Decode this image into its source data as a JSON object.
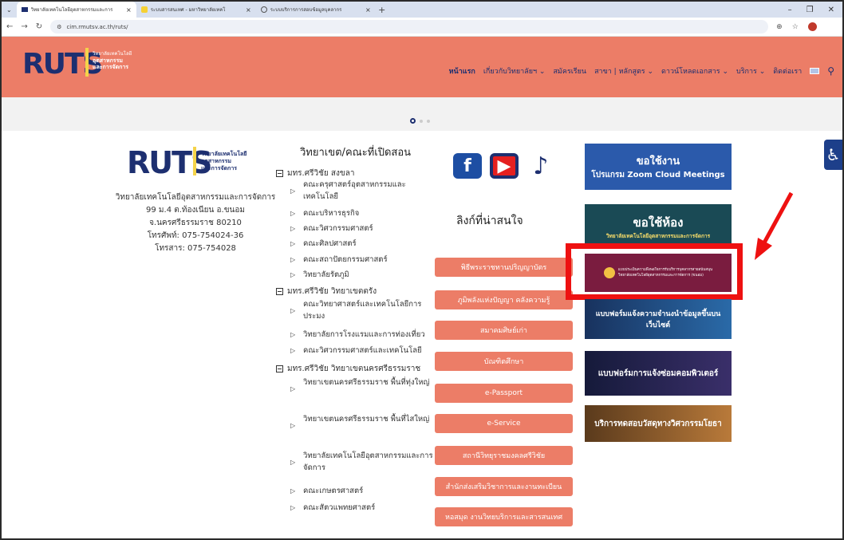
{
  "browser": {
    "tabs": [
      {
        "label": "วิทยาลัยเทคโนโลยีอุตสาหกรรมและการ"
      },
      {
        "label": "ระบบสารสนเทศ - มหาวิทยาลัยเทคโ"
      },
      {
        "label": "ระบบบริการการสอบข้อมูลบุคลากร"
      }
    ],
    "url": "cim.rmutsv.ac.th/ruts/"
  },
  "site": {
    "logo_text": "RUTS",
    "logo_sub": [
      "วิทยาลัยเทคโนโลยี",
      "อุตสาหกรรม",
      "และการจัดการ"
    ],
    "nav": [
      {
        "label": "หน้าแรก"
      },
      {
        "label": "เกี่ยวกับวิทยาลัยฯ ⌄"
      },
      {
        "label": "สมัครเรียน"
      },
      {
        "label": "สาขา | หลักสูตร ⌄"
      },
      {
        "label": "ดาวน์โหลดเอกสาร ⌄"
      },
      {
        "label": "บริการ ⌄"
      },
      {
        "label": "ติดต่อเรา"
      }
    ]
  },
  "footer_left": {
    "address_lines": [
      "วิทยาลัยเทคโนโลยีอุตสาหกรรมและการจัดการ",
      "99 ม.4 ต.ท้องเนียน อ.ขนอม",
      "จ.นครศรีธรรมราช 80210",
      "โทรศัพท์: 075-754024-36",
      "โทรสาร: 075-754028"
    ]
  },
  "campuses": {
    "title": "วิทยาเขต/คณะที่เปิดสอน",
    "songkhla": "มทร.ศรีวิชัย สงขลา",
    "trang": "มทร.ศรีวิชัย วิทยาเขตตรัง",
    "nakhon": "มทร.ศรีวิชัย วิทยาเขตนครศรีธรรมราช",
    "songkhla_items": [
      "คณะครุศาสตร์อุตสาหกรรมและเทคโนโลยี",
      "คณะบริหารธุรกิจ",
      "คณะวิศวกรรมศาสตร์",
      "คณะศิลปศาสตร์",
      "คณะสถาปัตยกรรมศาสตร์",
      "วิทยาลัยรัตภูมิ"
    ],
    "trang_items": [
      "คณะวิทยาศาสตร์และเทคโนโลยีการประมง",
      "วิทยาลัยการโรงแรมและการท่องเที่ยว",
      "คณะวิศวกรรมศาสตร์และเทคโนโลยี"
    ],
    "nakhon_items": [
      "วิทยาเขตนครศรีธรรมราช พื้นที่ทุ่งใหญ่",
      "วิทยาเขตนครศรีธรรมราช พื้นที่ไสใหญ่",
      "วิทยาลัยเทคโนโลยีอุตสาหกรรมและการจัดการ",
      "คณะเกษตรศาสตร์",
      "คณะสัตวแพทยศาสตร์"
    ]
  },
  "links": {
    "title": "ลิงก์ที่น่าสนใจ",
    "buttons": [
      "พิธีพระราชทานปริญญาบัตร",
      "ภูมิพลังแห่งปัญญา คลังความรู้",
      "สมาคมศิษย์เก่า",
      "บัณฑิตศึกษา",
      "e-Passport",
      "e-Service",
      "สถานีวิทยุราชมงคลศรีวิชัย",
      "สำนักส่งเสริมวิชาการและงานทะเบียน",
      "หอสมุด งานวิทยบริการและสารสนเทศ"
    ]
  },
  "banners": {
    "zoom_line1": "ขอใช้งาน",
    "zoom_line2": "โปรแกรม Zoom Cloud Meetings",
    "room_line1": "ขอใช้ห้อง",
    "room_line2": "วิทยาลัยเทคโนโลยีอุตสาหกรรมและการจัดการ",
    "survey_line1": "แบบประเมินความพึงพอใจการรับบริการบุคลากรสายสนับสนุน",
    "survey_line2": "วิทยาลัยเทคโนโลยีอุตสาหกรรมและการจัดการ (ขนอม)",
    "web_form": "แบบฟอร์มแจ้งความจำนงนำข้อมูลขึ้นบนเว็บไซต์",
    "repair_form": "แบบฟอร์มการแจ้งซ่อมคอมพิวเตอร์",
    "lab_test": "บริการทดสอบวัสดุทางวิศวกรรมโยธา"
  },
  "colors": {
    "header": "#ec7d67",
    "brand_blue": "#1d2f70",
    "highlight": "#ee1111"
  }
}
